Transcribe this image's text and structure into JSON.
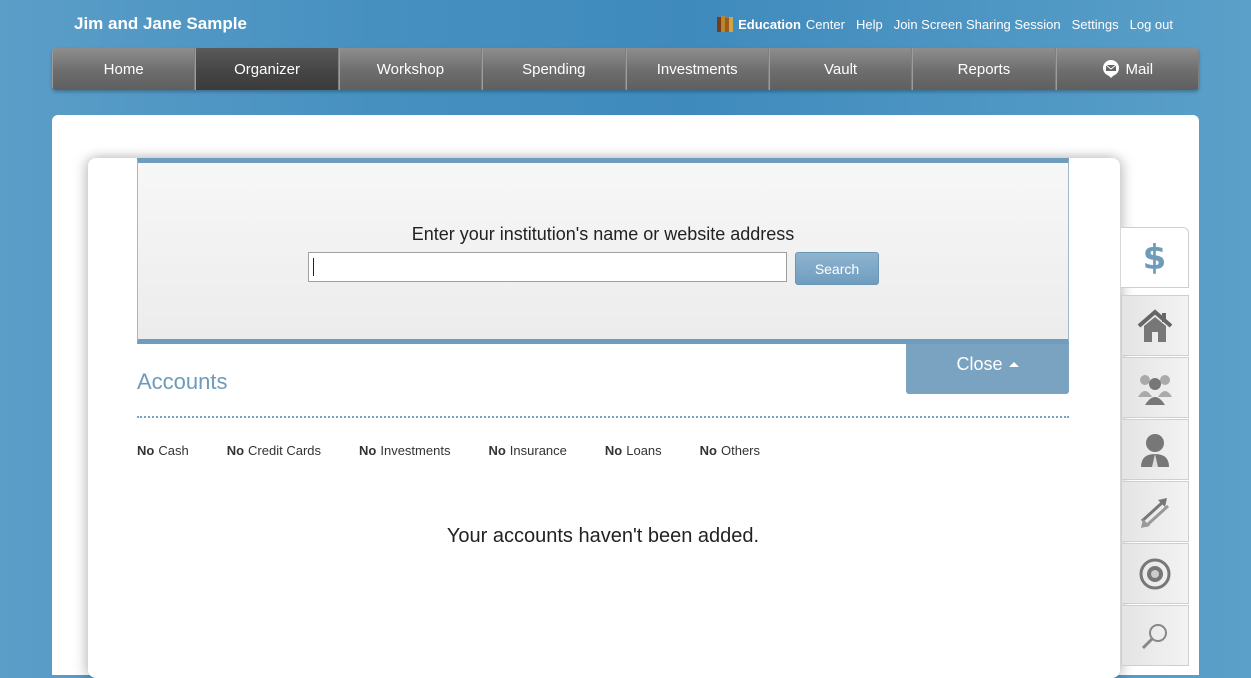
{
  "header": {
    "user_name": "Jim and Jane Sample",
    "links": {
      "education_bold": "Education",
      "education_rest": "Center",
      "help": "Help",
      "screen_sharing": "Join Screen Sharing Session",
      "settings": "Settings",
      "logout": "Log out"
    }
  },
  "nav": {
    "items": [
      "Home",
      "Organizer",
      "Workshop",
      "Spending",
      "Investments",
      "Vault",
      "Reports",
      "Mail"
    ],
    "active": "Organizer"
  },
  "search": {
    "heading": "Enter your institution's name or website address",
    "value": "",
    "button_label": "Search"
  },
  "close_tab": {
    "label": "Close"
  },
  "accounts": {
    "title": "Accounts",
    "categories": [
      {
        "prefix": "No",
        "label": "Cash"
      },
      {
        "prefix": "No",
        "label": "Credit Cards"
      },
      {
        "prefix": "No",
        "label": "Investments"
      },
      {
        "prefix": "No",
        "label": "Insurance"
      },
      {
        "prefix": "No",
        "label": "Loans"
      },
      {
        "prefix": "No",
        "label": "Others"
      }
    ],
    "empty_message": "Your accounts haven't been added."
  },
  "sidetabs": {
    "icons": [
      "dollar-icon",
      "home-icon",
      "people-icon",
      "person-icon",
      "transfer-icon",
      "target-icon",
      "search-icon"
    ],
    "dollar_glyph": "$"
  },
  "colors": {
    "accent": "#6f9bba",
    "nav_bg": "#6d6d6d",
    "nav_active": "#444444",
    "page_bg": "#4690c0"
  }
}
